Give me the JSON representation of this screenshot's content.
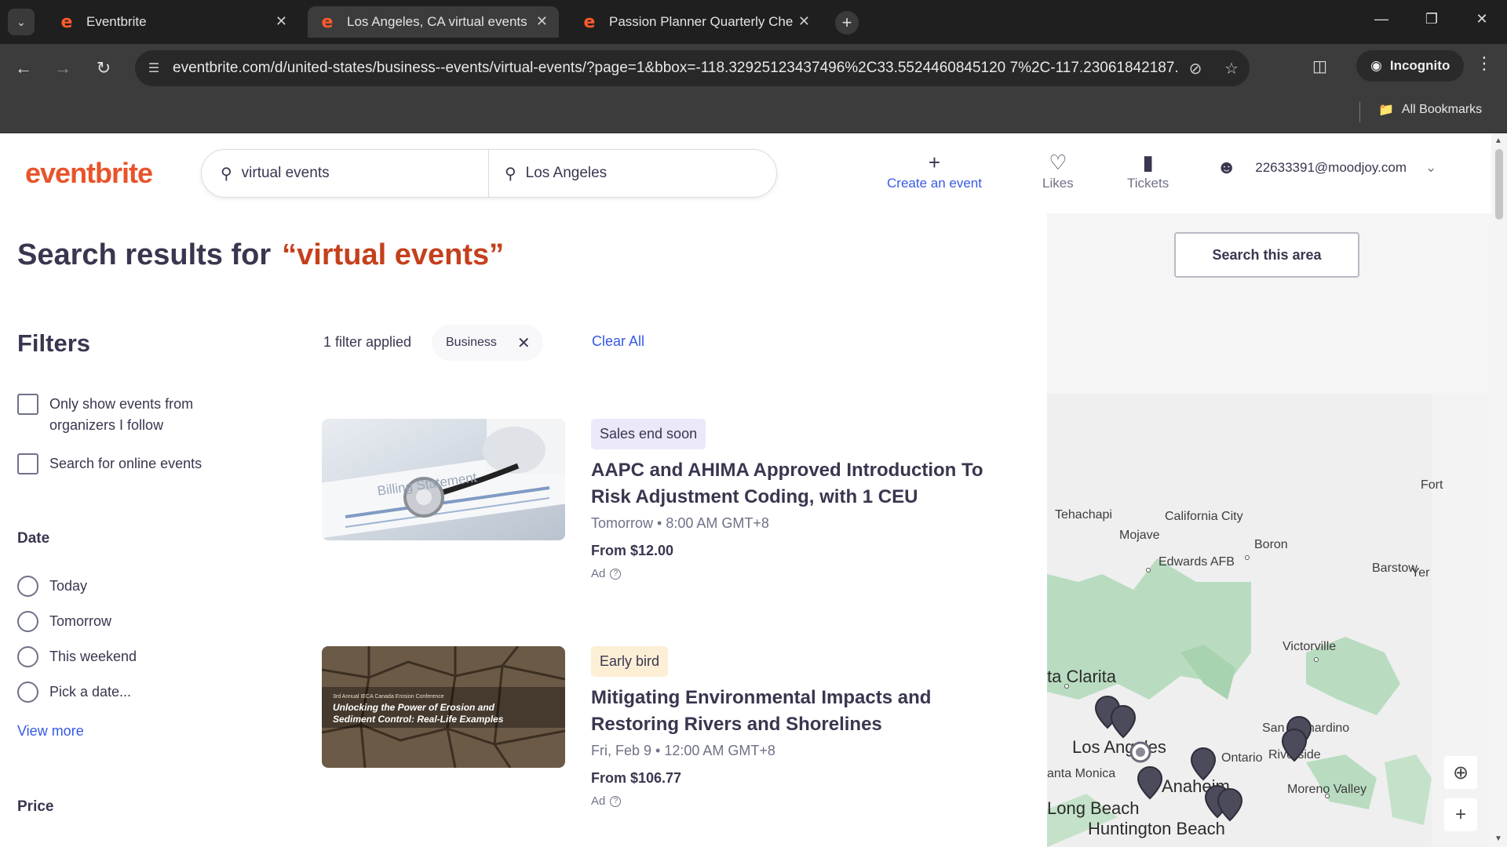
{
  "browser": {
    "tabs": [
      {
        "title": "Eventbrite",
        "active": false
      },
      {
        "title": "Los Angeles, CA virtual events",
        "active": true
      },
      {
        "title": "Passion Planner Quarterly Che",
        "active": false
      }
    ],
    "url": "eventbrite.com/d/united-states/business--events/virtual-events/?page=1&bbox=-118.32925123437496%2C33.5524460845120 7%2C-117.23061842187...",
    "profile_label": "Incognito",
    "bookmarks_label": "All Bookmarks"
  },
  "header": {
    "logo": "eventbrite",
    "search_query": "virtual events",
    "search_location": "Los Angeles",
    "create_label": "Create an event",
    "likes_label": "Likes",
    "tickets_label": "Tickets",
    "account_email": "22633391@moodjoy.com"
  },
  "results": {
    "prefix": "Search results for",
    "query": "“virtual events”"
  },
  "filters": {
    "title": "Filters",
    "options": [
      "Only show events from organizers I follow",
      "Search for online events"
    ],
    "date_title": "Date",
    "date_options": [
      "Today",
      "Tomorrow",
      "This weekend",
      "Pick a date..."
    ],
    "view_more": "View more",
    "price_title": "Price",
    "applied_text": "1 filter applied",
    "applied_chip": "Business",
    "clear_all": "Clear All"
  },
  "events": [
    {
      "badge": "Sales end soon",
      "title": "AAPC and AHIMA Approved Introduction To Risk Adjustment Coding, with 1 CEU",
      "date": "Tomorrow • 8:00 AM GMT+8",
      "price": "From $12.00",
      "ad": "Ad",
      "thumb_text": "Billing Statement"
    },
    {
      "badge": "Early bird",
      "title": "Mitigating Environmental Impacts and Restoring Rivers and Shorelines",
      "date": "Fri, Feb 9 • 12:00 AM GMT+8",
      "price": "From $106.77",
      "ad": "Ad",
      "thumb_small": "3rd Annual IECA Canada Erosion Conference",
      "thumb_text": "Unlocking the Power of Erosion and Sediment Control: Real-Life Examples"
    }
  ],
  "map": {
    "search_area": "Search this area",
    "places": [
      "Fort",
      "Tehachapi",
      "California City",
      "Mojave",
      "Boron",
      "Edwards AFB",
      "Barstow",
      "Yer",
      "Victorville",
      "ta Clarita",
      "Los Angeles",
      "Ontario",
      "San Bernardino",
      "Riverside",
      "anta Monica",
      "Anaheim",
      "Moreno Valley",
      "Long Beach",
      "Huntington Beach"
    ]
  },
  "colors": {
    "brand": "#e8542a",
    "link": "#3659e3",
    "text": "#39364f"
  }
}
